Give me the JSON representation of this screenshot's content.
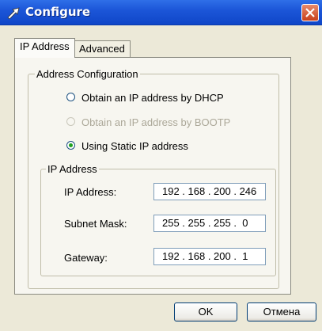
{
  "window": {
    "title": "Configure"
  },
  "tabs": [
    {
      "label": "IP Address",
      "active": true
    },
    {
      "label": "Advanced",
      "active": false
    }
  ],
  "address_config": {
    "group_label": "Address Configuration",
    "options": [
      {
        "label": "Obtain an IP address by DHCP",
        "selected": false,
        "enabled": true
      },
      {
        "label": "Obtain an IP address by BOOTP",
        "selected": false,
        "enabled": false
      },
      {
        "label": "Using Static IP address",
        "selected": true,
        "enabled": true
      }
    ]
  },
  "ip_group": {
    "group_label": "IP Address",
    "fields": [
      {
        "label": "IP Address:",
        "value": "192 . 168 . 200 . 246"
      },
      {
        "label": "Subnet Mask:",
        "value": "255 . 255 . 255 .  0"
      },
      {
        "label": "Gateway:",
        "value": "192 . 168 . 200 .  1"
      }
    ]
  },
  "buttons": {
    "ok": "OK",
    "cancel": "Отмена"
  },
  "icons": {
    "app": "arrow-tool-icon",
    "close": "close-icon"
  },
  "colors": {
    "titlebar": "#1c56d8",
    "close": "#c8401c",
    "radio_dot": "#21a121"
  }
}
